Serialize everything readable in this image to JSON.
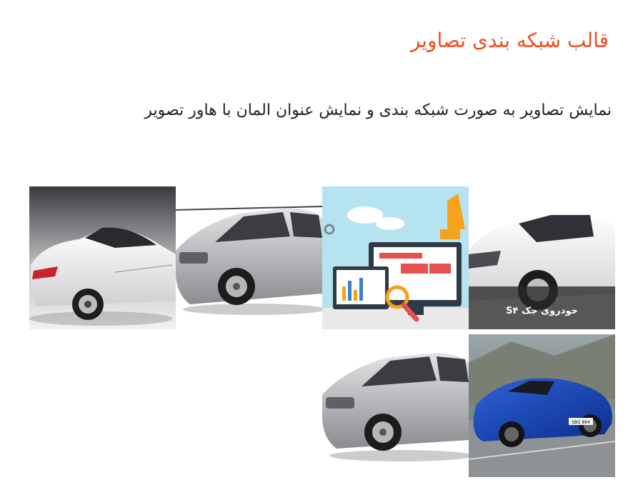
{
  "title": "قالب شبکه بندی تصاویر",
  "subtitle": "نمایش تصاویر به صورت شبکه بندی و نمایش عنوان المان با هاور تصویر",
  "colors": {
    "title": "#f24b1c",
    "text": "#222222",
    "caption_overlay": "#2b2b2b"
  },
  "tiles": [
    {
      "image": "white-sedan-image"
    },
    {
      "image": "silver-suv-image"
    },
    {
      "image": "web-design-illustration-image"
    },
    {
      "image": "white-crossover-image",
      "caption": "خودروی جک S۴"
    },
    {
      "image": "silver-suv-image"
    },
    {
      "image": "blue-sports-car-image"
    }
  ]
}
